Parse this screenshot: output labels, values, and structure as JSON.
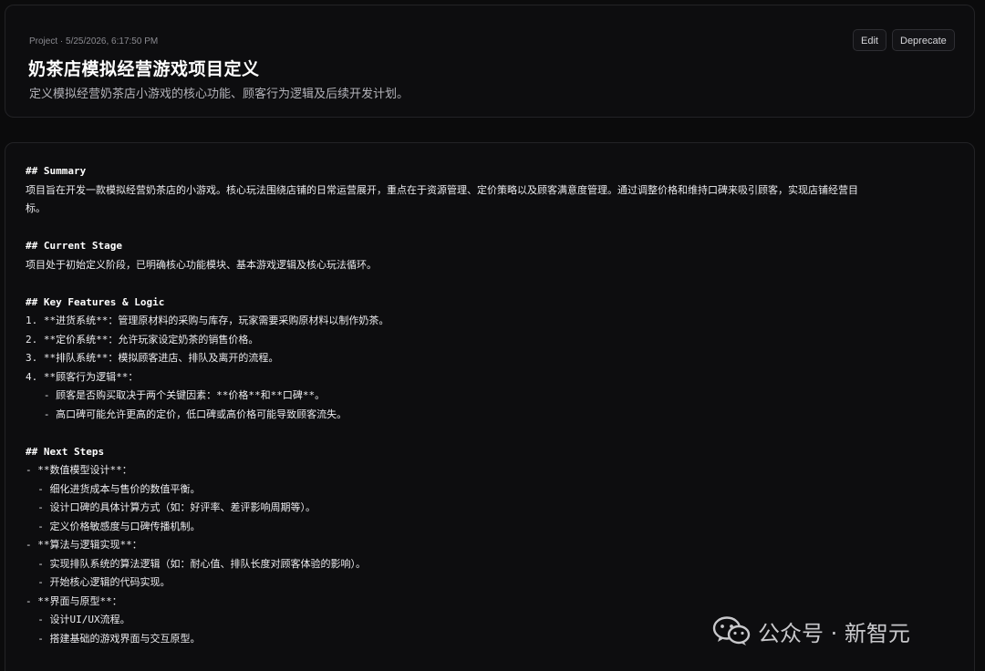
{
  "header": {
    "meta": "Project · 5/25/2026, 6:17:50 PM",
    "title": "奶茶店模拟经营游戏项目定义",
    "subtitle": "定义模拟经营奶茶店小游戏的核心功能、顾客行为逻辑及后续开发计划。",
    "edit_label": "Edit",
    "deprecate_label": "Deprecate"
  },
  "document": {
    "lines": [
      "## Summary",
      "项目旨在开发一款模拟经营奶茶店的小游戏。核心玩法围绕店铺的日常运营展开，重点在于资源管理、定价策略以及顾客满意度管理。通过调整价格和维持口碑来吸引顾客，实现店铺经营目",
      "标。",
      "",
      "## Current Stage",
      "项目处于初始定义阶段，已明确核心功能模块、基本游戏逻辑及核心玩法循环。",
      "",
      "## Key Features & Logic",
      "1. **进货系统**：管理原材料的采购与库存，玩家需要采购原材料以制作奶茶。",
      "2. **定价系统**：允许玩家设定奶茶的销售价格。",
      "3. **排队系统**：模拟顾客进店、排队及离开的流程。",
      "4. **顾客行为逻辑**：",
      "   - 顾客是否购买取决于两个关键因素：**价格**和**口碑**。",
      "   - 高口碑可能允许更高的定价，低口碑或高价格可能导致顾客流失。",
      "",
      "## Next Steps",
      "- **数值模型设计**：",
      "  - 细化进货成本与售价的数值平衡。",
      "  - 设计口碑的具体计算方式（如：好评率、差评影响周期等）。",
      "  - 定义价格敏感度与口碑传播机制。",
      "- **算法与逻辑实现**：",
      "  - 实现排队系统的算法逻辑（如：耐心值、排队长度对顾客体验的影响）。",
      "  - 开始核心逻辑的代码实现。",
      "- **界面与原型**：",
      "  - 设计UI/UX流程。",
      "  - 搭建基础的游戏界面与交互原型。"
    ]
  },
  "watermark": {
    "text": "公众号 · 新智元",
    "icon": "wechat-icon"
  }
}
